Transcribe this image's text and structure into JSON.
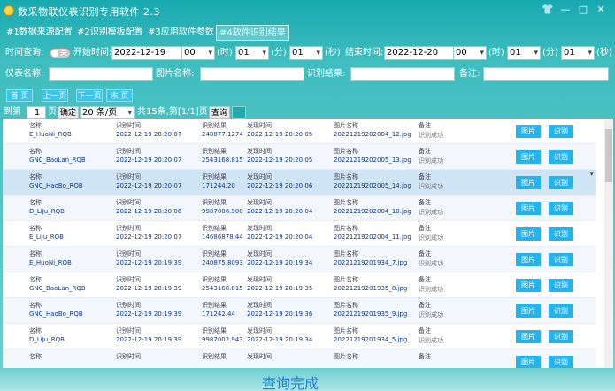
{
  "window": {
    "title": "数采物联仪表识别专用软件 2.3",
    "controls": [
      "👕",
      "—",
      "□",
      "✕"
    ]
  },
  "tabs": [
    "#1数据来源配置",
    "#2识别模板配置",
    "#3应用软件参数",
    "#4软件识别结果"
  ],
  "filter": {
    "time_query_label": "时间查询:",
    "toggle_text": "关",
    "start_label": "开始时间:",
    "start_date": "2022-12-19",
    "start_hour": "00",
    "start_min": "01",
    "start_sec": "01",
    "hour_unit": "(时)",
    "min_unit": "(分)",
    "sec_unit": "(秒)",
    "end_label": "结束时间:",
    "end_date": "2022-12-20",
    "end_hour": "00",
    "end_min": "01",
    "end_sec": "01",
    "meter_name_label": "仪表名称:",
    "image_name_label": "图片名称:",
    "result_label": "识别结果:",
    "note_label": "备注:"
  },
  "nav": {
    "first": "首 页",
    "prev": "上一页",
    "next": "下一页",
    "last": "末 页"
  },
  "pager": {
    "to_label": "到第",
    "page_input": "1",
    "page_unit": "页",
    "confirm": "确定",
    "page_size": "20 条/页",
    "summary": "共15条,第[1/1]页",
    "query": "查询"
  },
  "labels": {
    "name": "名称",
    "ident_time": "识别时间",
    "ident_result": "识别结果",
    "found_time": "发现时间",
    "image_name": "图片名称",
    "note": "备注",
    "btn_image": "图片",
    "btn_ident": "识别"
  },
  "records": [
    {
      "name": "E_HuoNi_RQB",
      "ident_time": "2022-12-19 20:20:07",
      "result": "240877.1274",
      "found_time": "2022-12-19 20:20:05",
      "image": "20221219202004_12.jpg",
      "note": "识别成功"
    },
    {
      "name": "GNC_BaoLan_RQB",
      "ident_time": "2022-12-19 20:20:07",
      "result": "2543168.815",
      "found_time": "2022-12-19 20:20:05",
      "image": "20221219202005_13.jpg",
      "note": "识别成功"
    },
    {
      "name": "GNC_HaoBo_RQB",
      "ident_time": "2022-12-19 20:20:07",
      "result": "171244.20",
      "found_time": "2022-12-19 20:20:06",
      "image": "20221219202005_14.jpg",
      "note": "识别成功"
    },
    {
      "name": "D_LiJu_RQB",
      "ident_time": "2022-12-19 20:20:06",
      "result": "9987006.900",
      "found_time": "2022-12-19 20:20:04",
      "image": "20221219202004_10.jpg",
      "note": "识别成功"
    },
    {
      "name": "E_LiJu_RQB",
      "ident_time": "2022-12-19 20:20:07",
      "result": "14686878.44",
      "found_time": "2022-12-19 20:20:04",
      "image": "20221219202004_11.jpg",
      "note": "识别成功"
    },
    {
      "name": "E_HuoNi_RQB",
      "ident_time": "2022-12-19 20:19:39",
      "result": "240875.8093",
      "found_time": "2022-12-19 20:19:34",
      "image": "20221219201934_7.jpg",
      "note": "识别成功"
    },
    {
      "name": "GNC_BaoLan_RQB",
      "ident_time": "2022-12-19 20:19:39",
      "result": "2543168.815",
      "found_time": "2022-12-19 20:19:35",
      "image": "20221219201935_8.jpg",
      "note": "识别成功"
    },
    {
      "name": "GNC_HaoBo_RQB",
      "ident_time": "2022-12-19 20:19:39",
      "result": "171242.44",
      "found_time": "2022-12-19 20:19:36",
      "image": "20221219201935_9.jpg",
      "note": "识别成功"
    },
    {
      "name": "D_LiJu_RQB",
      "ident_time": "2022-12-19 20:19:39",
      "result": "9987002.943",
      "found_time": "2022-12-19 20:19:34",
      "image": "20221219201934_5.jpg",
      "note": "识别成功"
    },
    {
      "name": "",
      "ident_time": "",
      "result": "",
      "found_time": "",
      "image": "",
      "note": ""
    }
  ],
  "status": "查询完成",
  "colors": {
    "accent": "#26b2ea",
    "selected_row": "#cfe5f6",
    "value_text": "#0a3a93",
    "status_text": "#1b80d8"
  }
}
